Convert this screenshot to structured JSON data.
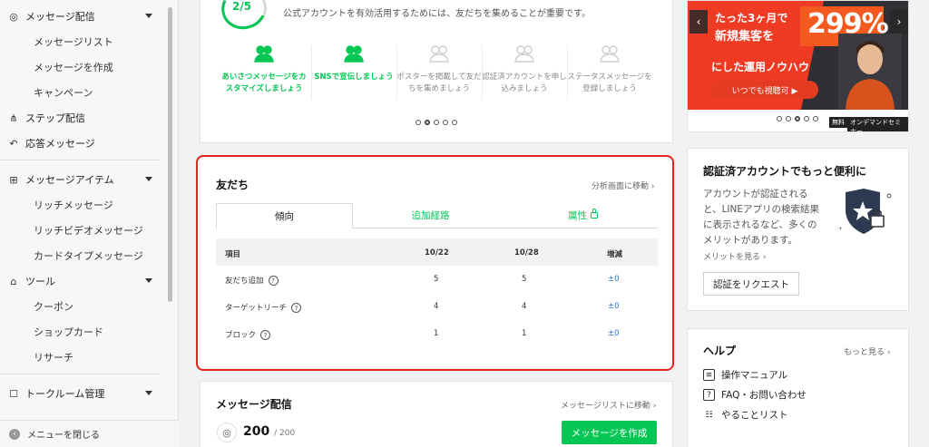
{
  "sidebar": {
    "sections": [
      {
        "label": "メッセージ配信",
        "icon": "broadcast-icon",
        "expandable": true
      },
      {
        "label": "ステップ配信",
        "icon": "step-flow-icon",
        "expandable": false
      },
      {
        "label": "応答メッセージ",
        "icon": "reply-icon",
        "expandable": false
      },
      {
        "label": "メッセージアイテム",
        "icon": "add-item-icon",
        "expandable": true
      },
      {
        "label": "ツール",
        "icon": "store-icon",
        "expandable": true
      },
      {
        "label": "トークルーム管理",
        "icon": "talk-room-icon",
        "expandable": true
      }
    ],
    "message_items": [
      "メッセージリスト",
      "メッセージを作成",
      "キャンペーン"
    ],
    "item_items": [
      "リッチメッセージ",
      "リッチビデオメッセージ",
      "カードタイプメッセージ"
    ],
    "tool_items": [
      "クーポン",
      "ショップカード",
      "リサーチ"
    ],
    "footer_label": "メニューを閉じる"
  },
  "progress": {
    "value": "2/5",
    "description": "公式アカウントを有効活用するためには、友だちを集めることが重要です。",
    "steps": [
      {
        "label": "あいさつメッセージをカスタマイズしましょう",
        "done": true
      },
      {
        "label": "SNSで宣伝しましょう",
        "done": true
      },
      {
        "label": "ポスターを掲載して友だちを集めましょう",
        "done": false
      },
      {
        "label": "認証済アカウントを申し込みましょう",
        "done": false
      },
      {
        "label": "ステータスメッセージを登録しましょう",
        "done": false
      }
    ],
    "dots": 5,
    "active_dot": 1
  },
  "friends": {
    "title": "友だち",
    "analysis_link": "分析画面に移動",
    "tabs": [
      "傾向",
      "追加経路",
      "属性"
    ],
    "active_tab": 0,
    "columns": [
      "項目",
      "10/22",
      "10/28",
      "増減"
    ],
    "rows": [
      {
        "name": "友だち追加",
        "a": "5",
        "b": "5",
        "diff": "±0"
      },
      {
        "name": "ターゲットリーチ",
        "a": "4",
        "b": "4",
        "diff": "±0"
      },
      {
        "name": "ブロック",
        "a": "1",
        "b": "1",
        "diff": "±0"
      }
    ]
  },
  "message": {
    "title": "メッセージ配信",
    "list_link": "メッセージリストに移動",
    "count": "200",
    "limit": "/ 200",
    "create_button": "メッセージを作成"
  },
  "banner": {
    "line1": "たった3ヶ月で",
    "line2": "新規集客を",
    "percent": "299%",
    "line3": "にした運用ノウハウ",
    "cta": "いつでも視聴可 ▶",
    "tag1": "無料",
    "tag2": "オンデマンドセミナー",
    "dots": 5,
    "active_dot": 2
  },
  "verified": {
    "title": "認証済アカウントでもっと便利に",
    "text": "アカウントが認証されると、LINEアプリの検索結果に表示されるなど、多くのメリットがあります。",
    "text_lines": [
      "アカウントが認証される",
      "と、LINEアプリの検索結果",
      "に表示されるなど、多くの",
      "メリットがあります。"
    ],
    "more_link": "メリットを見る",
    "request_button": "認証をリクエスト"
  },
  "help": {
    "title": "ヘルプ",
    "more_link": "もっと見る",
    "items": [
      {
        "label": "操作マニュアル",
        "icon": "book-icon"
      },
      {
        "label": "FAQ・お問い合わせ",
        "icon": "question-icon"
      },
      {
        "label": "やることリスト",
        "icon": "checklist-icon"
      }
    ]
  }
}
